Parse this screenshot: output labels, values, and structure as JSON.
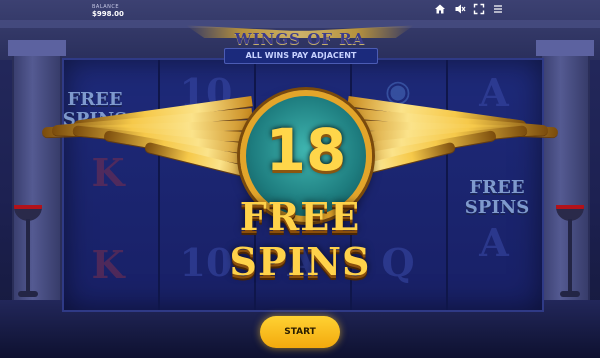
{
  "hud": {
    "balance_label": "BALANCE",
    "balance_value": "$998.00",
    "icons": [
      "home-icon",
      "sound-off-icon",
      "fullscreen-icon",
      "menu-icon"
    ]
  },
  "game": {
    "title": "WINGS OF RA",
    "subtitle": "ALL WINS PAY ADJACENT"
  },
  "bonus": {
    "spins_count": "18",
    "spins_label": "FREE SPINS"
  },
  "reels": {
    "scatter_left": [
      "FREE",
      "SPINS"
    ],
    "scatter_right": [
      "FREE",
      "SPINS"
    ]
  },
  "controls": {
    "start_label": "START"
  },
  "colors": {
    "accent_gold": "#f5c542",
    "background": "#1f2459",
    "medal": "#2a9a98"
  }
}
